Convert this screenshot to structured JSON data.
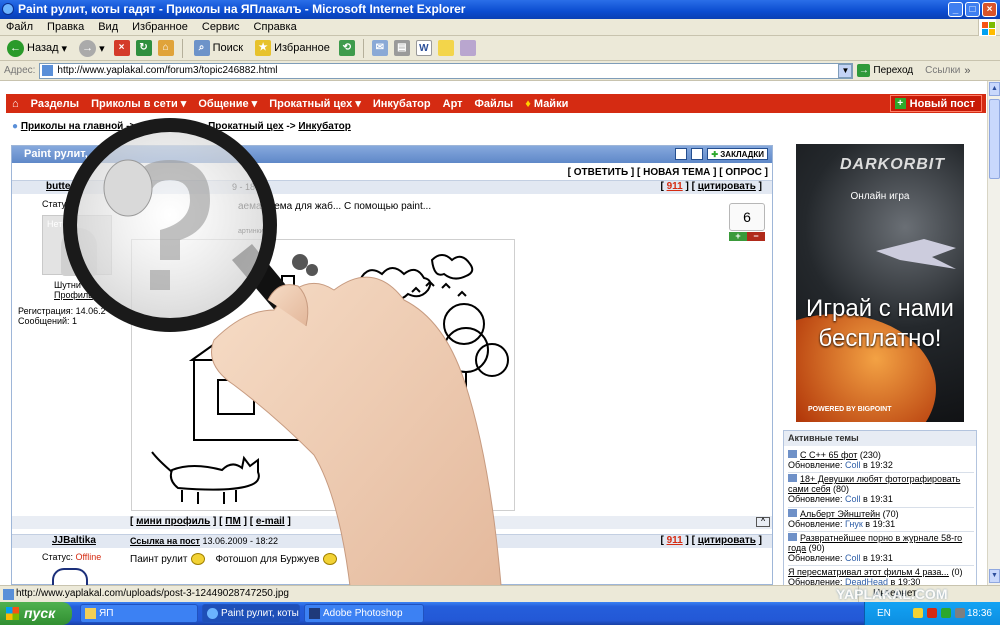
{
  "window": {
    "title": "Paint рулит, коты гадят - Приколы на ЯПлакалъ - Microsoft Internet Explorer",
    "buttons": [
      "_",
      "□",
      "×"
    ]
  },
  "menu": [
    "Файл",
    "Правка",
    "Вид",
    "Избранное",
    "Сервис",
    "Справка"
  ],
  "toolbar": {
    "back": "Назад",
    "search": "Поиск",
    "favorites": "Избранное"
  },
  "address": {
    "label": "Адрес:",
    "url": "http://www.yaplakal.com/forum3/topic246882.html",
    "go": "Переход",
    "links": "Ссылки"
  },
  "nav": {
    "items": [
      "Разделы",
      "Приколы в сети ▾",
      "Общение ▾",
      "Прокатный цех ▾",
      "Инкубатор",
      "Арт",
      "Файлы",
      "Майки"
    ],
    "new_post": "Новый пост"
  },
  "breadcrumb": {
    "home": "Приколы на главной",
    "sep": "->",
    "parent": "Прокатный цех",
    "current": "Инкубатор"
  },
  "topic": {
    "title": "Paint рулит,",
    "bookmarks": "ЗАКЛАДКИ",
    "actions": "[ ОТВЕТИТЬ ] [ НОВАЯ ТЕМА ] [ ОПРОС ]"
  },
  "post1": {
    "author": "butte",
    "meta": "9 - 18:",
    "num": "911",
    "quote": "цитировать",
    "status_label": "Статус",
    "avatar_text": "Нет",
    "rank": "Шутни",
    "profile": "Профиль",
    "registered": "Регистрация: 14.06.2",
    "messages": "Сообщений: 1",
    "text": "аемая тема для жаб... С помощью paint...",
    "tiny_label": "артинки",
    "rating": "6",
    "plus": "+",
    "minus": "−",
    "watermark": "AL.COM",
    "footer": {
      "mini_profile": "мини профиль",
      "pm": "ПМ",
      "email": "e-mail",
      "to_top": "^"
    }
  },
  "post2": {
    "author": "JJBaltika",
    "link": "Ссылка на пост",
    "date": "13.06.2009 - 18:22",
    "num": "911",
    "quote": "цитировать",
    "status_label": "Статус:",
    "status": "Offline",
    "text1": "Паинт рулит",
    "text2": "Фотошоп для Буржуев"
  },
  "ad": {
    "logo": "DARKORBIT",
    "subtitle": "Онлайн игра",
    "headline": "Играй с нами бесплатно!",
    "powered": "POWERED BY BIGPOINT"
  },
  "active_topics": {
    "title": "Активные темы",
    "items": [
      {
        "title": "С С++ 65 фот",
        "count": "(230)",
        "updated": "Обновление:",
        "user": "Coll",
        "time": "в 19:32"
      },
      {
        "title": "18+ Девушки любят фотографировать сами себя",
        "count": "(80)",
        "updated": "Обновление:",
        "user": "Coll",
        "time": "в 19:31"
      },
      {
        "title": "Альберт Эйнштейн",
        "count": "(70)",
        "updated": "Обновление:",
        "user": "Гнук",
        "time": "в 19:31"
      },
      {
        "title": "Развратнейшее порно в журнале 58-го года",
        "count": "(90)",
        "updated": "Обновление:",
        "user": "Coll",
        "time": "в 19:31"
      },
      {
        "title": "Я пересматривал этот фильм 4 раза...",
        "count": "(0)",
        "updated": "Обновление:",
        "user": "DeadHead",
        "time": "в 19:30"
      }
    ]
  },
  "statusbar": {
    "url": "http://www.yaplakal.com/uploads/post-3-12449028747250.jpg",
    "zone": "Интернет"
  },
  "taskbar": {
    "start": "пуск",
    "tasks": [
      "ЯП",
      "Paint рулит, коты га...",
      "Adobe Photoshop"
    ],
    "lang": "EN",
    "clock": "18:36"
  },
  "site_watermark": "YAPLAKAL.COM"
}
